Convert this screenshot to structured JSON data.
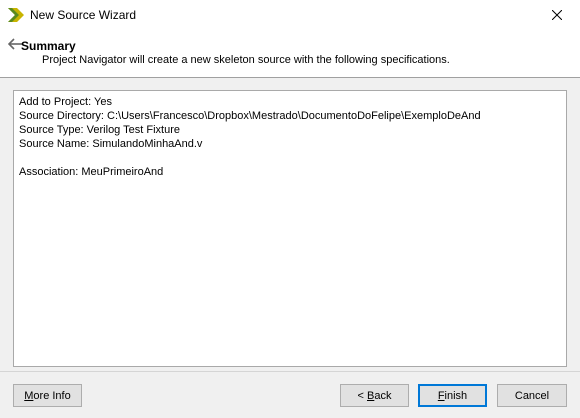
{
  "window": {
    "title": "New Source Wizard",
    "app_icon": "xilinx-chevron-icon",
    "close_icon": "close-icon"
  },
  "header": {
    "title": "Summary",
    "description": "Project Navigator will create a new skeleton source with the following specifications.",
    "back_icon": "back-arrow-icon"
  },
  "summary": {
    "lines": [
      "Add to Project: Yes",
      "Source Directory: C:\\Users\\Francesco\\Dropbox\\Mestrado\\DocumentoDoFelipe\\ExemploDeAnd",
      "Source Type: Verilog Test Fixture",
      "Source Name: SimulandoMinhaAnd.v",
      "",
      "Association: MeuPrimeiroAnd"
    ]
  },
  "buttons": {
    "more_info": {
      "mnemonic": "M",
      "rest": "ore Info"
    },
    "back": {
      "prefix": "< ",
      "mnemonic": "B",
      "rest": "ack"
    },
    "finish": {
      "mnemonic": "F",
      "rest": "inish"
    },
    "cancel": {
      "label": "Cancel"
    }
  },
  "colors": {
    "default_button_border": "#0078d7",
    "icon_yellow": "#c8b400",
    "icon_green": "#5a8a1e"
  }
}
